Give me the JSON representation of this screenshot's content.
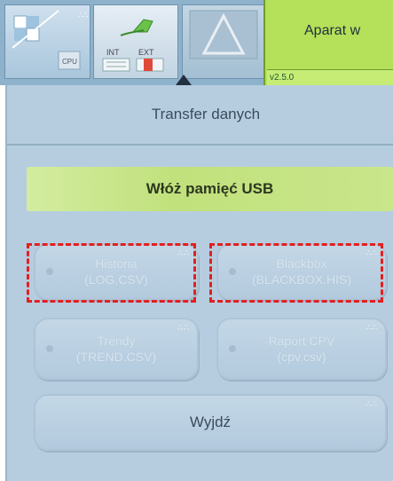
{
  "header": {
    "status_title": "Aparat w",
    "version": "v2.5.0",
    "tile_labels": {
      "int": "INT",
      "ext": "EXT",
      "cpu": "CPU"
    }
  },
  "panel": {
    "title": "Transfer danych",
    "usb_prompt": "Włóż pamięć USB",
    "buttons": {
      "history": {
        "line1": "Historia",
        "line2": "(LOG.CSV)"
      },
      "blackbox": {
        "line1": "Blackbox",
        "line2": "(BLACKBOX.HIS)"
      },
      "trends": {
        "line1": "Trendy",
        "line2": "(TREND.CSV)"
      },
      "cpv": {
        "line1": "Raport CPV",
        "line2": "(cpv.csv)"
      },
      "exit": {
        "line1": "Wyjdź"
      }
    }
  },
  "colors": {
    "status_green": "#b4e05a",
    "panel_blue": "#b6cde0",
    "highlight_red": "#e31f1f"
  }
}
